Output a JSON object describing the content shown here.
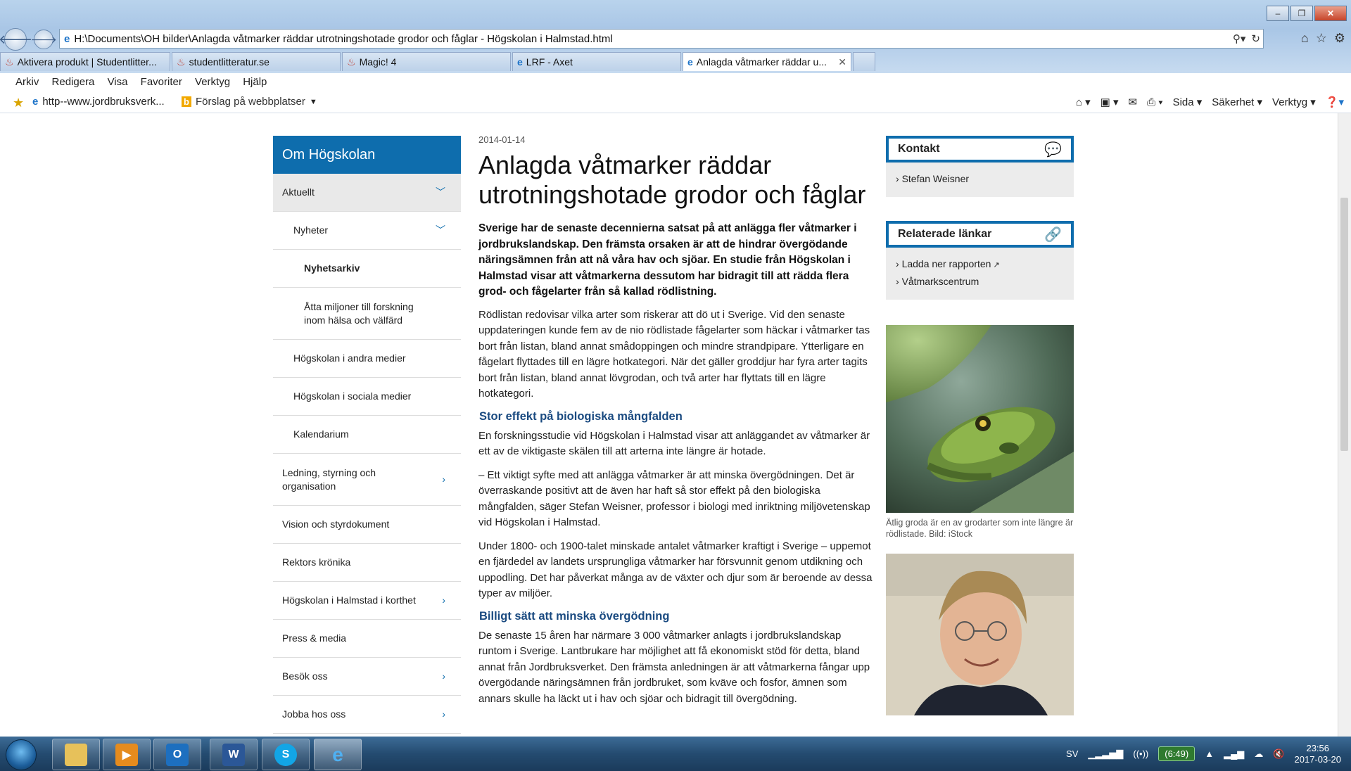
{
  "browser": {
    "address": "H:\\Documents\\OH bilder\\Anlagda våtmarker räddar utrotningshotade grodor och fåglar - Högskolan i Halmstad.html",
    "tabs": [
      {
        "label": "Aktivera produkt | Studentlitter..."
      },
      {
        "label": "studentlitteratur.se"
      },
      {
        "label": "Magic! 4"
      },
      {
        "label": "LRF - Axet"
      },
      {
        "label": "Anlagda våtmarker räddar u..."
      }
    ],
    "menu": [
      "Arkiv",
      "Redigera",
      "Visa",
      "Favoriter",
      "Verktyg",
      "Hjälp"
    ],
    "favorites": {
      "item1": "http--www.jordbruksverk...",
      "item2": "Förslag på webbplatser"
    },
    "commands": {
      "page": "Sida",
      "safety": "Säkerhet",
      "tools": "Verktyg"
    }
  },
  "leftnav": {
    "header": "Om Högskolan",
    "items": [
      {
        "label": "Aktuellt"
      },
      {
        "label": "Nyheter"
      },
      {
        "label": "Nyhetsarkiv"
      },
      {
        "label": "Åtta miljoner till forskning inom hälsa och välfärd"
      },
      {
        "label": "Högskolan i andra medier"
      },
      {
        "label": "Högskolan i sociala medier"
      },
      {
        "label": "Kalendarium"
      },
      {
        "label": "Ledning, styrning och organisation"
      },
      {
        "label": "Vision och styrdokument"
      },
      {
        "label": "Rektors krönika"
      },
      {
        "label": "Högskolan i Halmstad i korthet"
      },
      {
        "label": "Press & media"
      },
      {
        "label": "Besök oss"
      },
      {
        "label": "Jobba hos oss"
      }
    ]
  },
  "article": {
    "date": "2014-01-14",
    "title": "Anlagda våtmarker räddar utrotningshotade grodor och fåglar",
    "lead": "Sverige har de senaste decennierna satsat på att anlägga fler våtmarker i jordbrukslandskap. Den främsta orsaken är att de hindrar övergödande näringsämnen från att nå våra hav och sjöar. En studie från Högskolan i Halmstad visar att våtmarkerna dessutom har bidragit till att rädda flera grod- och fågelarter från så kallad rödlistning.",
    "p1": "Rödlistan redovisar vilka arter som riskerar att dö ut i Sverige. Vid den senaste uppdateringen kunde fem av de nio rödlistade fågelarter som häckar i våtmarker tas bort från listan, bland annat smådoppingen och mindre strandpipare. Ytterligare en fågelart flyttades till en lägre hotkategori. När det gäller groddjur har fyra arter tagits bort från listan, bland annat lövgrodan, och två arter har flyttats till en lägre hotkategori.",
    "h2a": "Stor effekt på biologiska mångfalden",
    "p2": "En forskningsstudie vid Högskolan i Halmstad visar att anläggandet av våtmarker är ett av de viktigaste skälen till att arterna inte längre är hotade.",
    "p3": "– Ett viktigt syfte med att anlägga våtmarker är att minska övergödningen. Det är överraskande positivt att de även har haft så stor effekt på den biologiska mångfalden, säger Stefan Weisner, professor i biologi med inriktning miljövetenskap vid Högskolan i Halmstad.",
    "p4": "Under 1800- och 1900-talet minskade antalet våtmarker kraftigt i Sverige – uppemot en fjärdedel av landets ursprungliga våtmarker har försvunnit genom utdikning och uppodling. Det har påverkat många av de växter och djur som är beroende av dessa typer av miljöer.",
    "h2b": "Billigt sätt att minska övergödning",
    "p5": "De senaste 15 åren har närmare 3 000 våtmarker anlagts i jordbrukslandskap runtom i Sverige. Lantbrukare har möjlighet att få ekonomiskt stöd för detta, bland annat från Jordbruksverket. Den främsta anledningen är att våtmarkerna fångar upp övergödande näringsämnen från jordbruket, som kväve och fosfor, ämnen som annars skulle ha läckt ut i hav och sjöar och bidragit till övergödning."
  },
  "sidebar": {
    "contact_title": "Kontakt",
    "contact_name": "Stefan Weisner",
    "links_title": "Relaterade länkar",
    "link1": "Ladda ner rapporten",
    "link2": "Våtmarkscentrum",
    "caption": "Ätlig groda är en av grodarter som inte längre är rödlistade. Bild: iStock"
  },
  "taskbar": {
    "lang": "SV",
    "battery": "(6:49)",
    "time": "23:56",
    "date": "2017-03-20"
  },
  "colors": {
    "accent": "#0e6dad",
    "subheading": "#1a4a80"
  }
}
